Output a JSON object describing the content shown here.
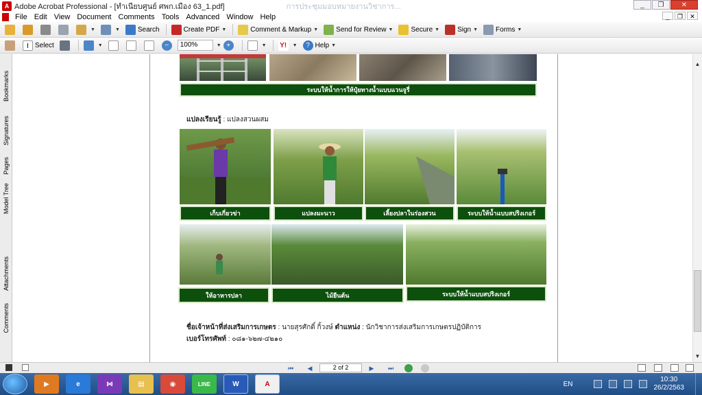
{
  "window": {
    "title": "Adobe Acrobat Professional - [ทำเนียบศูนย์ ศพก.เมือง 63_1.pdf]",
    "ghost_title": "การประชุมมอบหมายงานวิชาการ...",
    "controls": [
      "_",
      "❐",
      "✕"
    ]
  },
  "menu": {
    "items": [
      "File",
      "Edit",
      "View",
      "Document",
      "Comments",
      "Tools",
      "Advanced",
      "Window",
      "Help"
    ],
    "doc_controls": [
      "_",
      "❐",
      "✕"
    ]
  },
  "toolbar1": {
    "search": "Search",
    "create_pdf": "Create PDF",
    "comment_markup": "Comment & Markup",
    "send_review": "Send for Review",
    "secure": "Secure",
    "sign": "Sign",
    "forms": "Forms"
  },
  "toolbar2": {
    "select": "Select",
    "zoom": "100%",
    "help": "Help",
    "yahoo": "Y!"
  },
  "nav_tabs": [
    "Bookmarks",
    "Signatures",
    "Pages",
    "Model Tree",
    "Attachments",
    "Comments"
  ],
  "page": {
    "top_caption": "ระบบให้น้ำการให้ปุ๋ยทางน้ำแบบแวนจูรี่",
    "plot_heading": "แปลงเรียนรู้",
    "plot_value": " : แปลงสวนผสม",
    "row1_captions": [
      "เก็บเกี่ยวข่า",
      "แปลงมะนาว",
      "เลี้ยงปลาในร่องสวน",
      "ระบบให้น้ำแบบสปริงเกอร์"
    ],
    "row2_captions": [
      "ให้อาหารปลา",
      "ไม้ยืนต้น",
      "ระบบให้น้ำแบบสปริงเกอร์"
    ],
    "officer_label": "ชื่อเจ้าหน้าที่ส่งเสริมการเกษตร",
    "officer_name": " : นายสุรศักดิ์ กิ้วงษ์ ",
    "position_label": "ตำแหน่ง",
    "position_value": " : นักวิชาการส่งเสริมการเกษตรปฏิบัติการ",
    "phone_label": "เบอร์โทรศัพท์",
    "phone_value": " : ๐๘๑-๖๒๗-๔๒๑๐"
  },
  "status": {
    "page_indicator": "2 of 2"
  },
  "taskbar": {
    "apps": [
      "Windows Media Player",
      "Internet Explorer",
      "Visual Studio",
      "File Explorer",
      "Google Chrome",
      "LINE",
      "Microsoft Word",
      "Adobe Acrobat"
    ],
    "app_icons": [
      "▶",
      "e",
      "⋈",
      "▤",
      "◉",
      "LINE",
      "W",
      "A"
    ],
    "language": "EN",
    "time": "10:30",
    "date": "26/2/2563"
  },
  "colors": {
    "caption_bg": "#0d4f0d",
    "taskbar": "#1f4d86"
  }
}
